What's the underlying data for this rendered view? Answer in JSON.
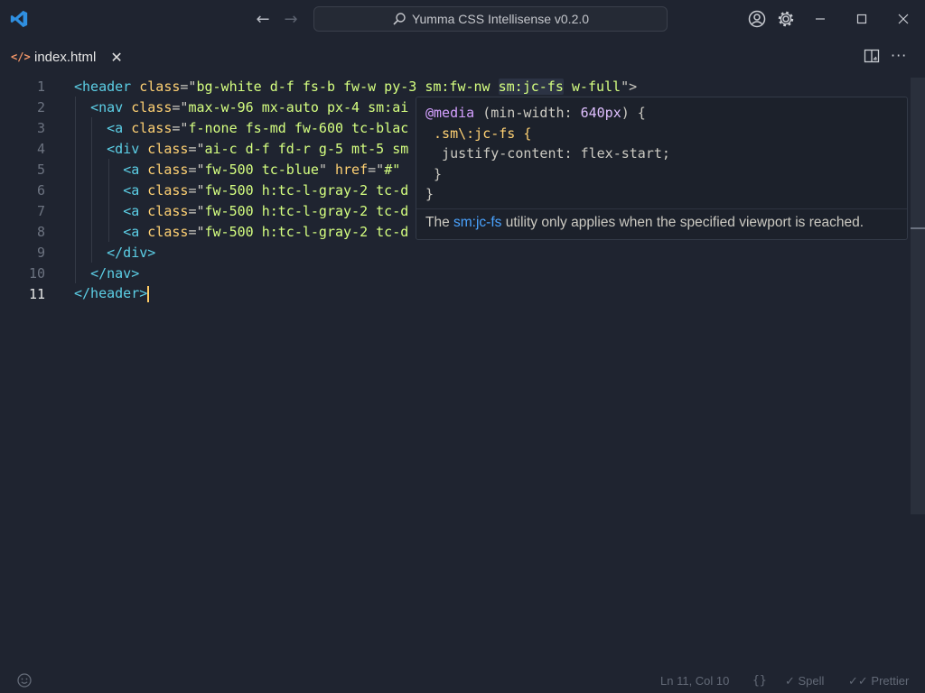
{
  "titlebar": {
    "search_text": "Yumma CSS Intellisense v0.2.0",
    "icons": [
      "vscode-logo-icon",
      "arrow-left-icon",
      "arrow-right-icon",
      "search-icon",
      "account-icon",
      "gear-icon",
      "minimize-icon",
      "maximize-icon",
      "close-icon"
    ]
  },
  "tab": {
    "label": "index.html",
    "icon": "html-file-icon",
    "file_icon_glyph": "</>",
    "close_glyph": "✕"
  },
  "editor": {
    "active_line": 11,
    "lines": [
      {
        "n": "1"
      },
      {
        "n": "2"
      },
      {
        "n": "3"
      },
      {
        "n": "4"
      },
      {
        "n": "5"
      },
      {
        "n": "6"
      },
      {
        "n": "7"
      },
      {
        "n": "8"
      },
      {
        "n": "9"
      },
      {
        "n": "10"
      },
      {
        "n": "11"
      }
    ],
    "code": {
      "l1": {
        "open": "<header",
        "attr": "class",
        "eq": "=\"",
        "v1": "bg-white d-f fs-b fw-w py-3 sm:fw-nw ",
        "v2": "sm:jc-fs",
        "v3": " w-full",
        "close": "\">"
      },
      "l2": {
        "open": "<nav",
        "attr": "class",
        "eq": "=\"",
        "v": "max-w-96 mx-auto px-4 sm:ai"
      },
      "l3": {
        "open": "<a",
        "attr": "class",
        "eq": "=\"",
        "v": "f-none fs-md fw-600 tc-blac"
      },
      "l4": {
        "open": "<div",
        "attr": "class",
        "eq": "=\"",
        "v": "ai-c d-f fd-r g-5 mt-5 sm"
      },
      "l5": {
        "open": "<a",
        "attr": "class",
        "eq": "=\"",
        "v": "fw-500 tc-blue",
        "q": "\"",
        "attr2": "href",
        "eq2": "=\"",
        "v2": "#\""
      },
      "l6": {
        "open": "<a",
        "attr": "class",
        "eq": "=\"",
        "v": "fw-500 h:tc-l-gray-2 tc-d"
      },
      "l7": {
        "open": "<a",
        "attr": "class",
        "eq": "=\"",
        "v": "fw-500 h:tc-l-gray-2 tc-d"
      },
      "l8": {
        "open": "<a",
        "attr": "class",
        "eq": "=\"",
        "v": "fw-500 h:tc-l-gray-2 tc-d"
      },
      "l9": {
        "close": "</div>"
      },
      "l10": {
        "close": "</nav>"
      },
      "l11": {
        "close_a": "</header",
        "close_b": ">"
      }
    }
  },
  "hover": {
    "code_lines": {
      "at": "@media",
      "cond_a": " (min-width: ",
      "num": "640px",
      "cond_b": ") {",
      "selector": " .sm\\:jc-fs {",
      "decl": "  justify-content: flex-start;",
      "close_inner": " }",
      "close_outer": "}"
    },
    "desc_pre": "The ",
    "desc_link": "sm:jc-fs",
    "desc_post": " utility only applies when the specified viewport is reached."
  },
  "statusbar": {
    "position": "Ln 11, Col 10",
    "braces": "{}",
    "spell": "✓ Spell",
    "prettier": "✓✓ Prettier",
    "icons": [
      "feedback-icon"
    ]
  },
  "colors": {
    "background": "#1f2430",
    "tag": "#5ccfe6",
    "attribute": "#ffd173",
    "string": "#d5ff80",
    "link": "#4aa3ff",
    "cursor": "#ffcc66"
  }
}
